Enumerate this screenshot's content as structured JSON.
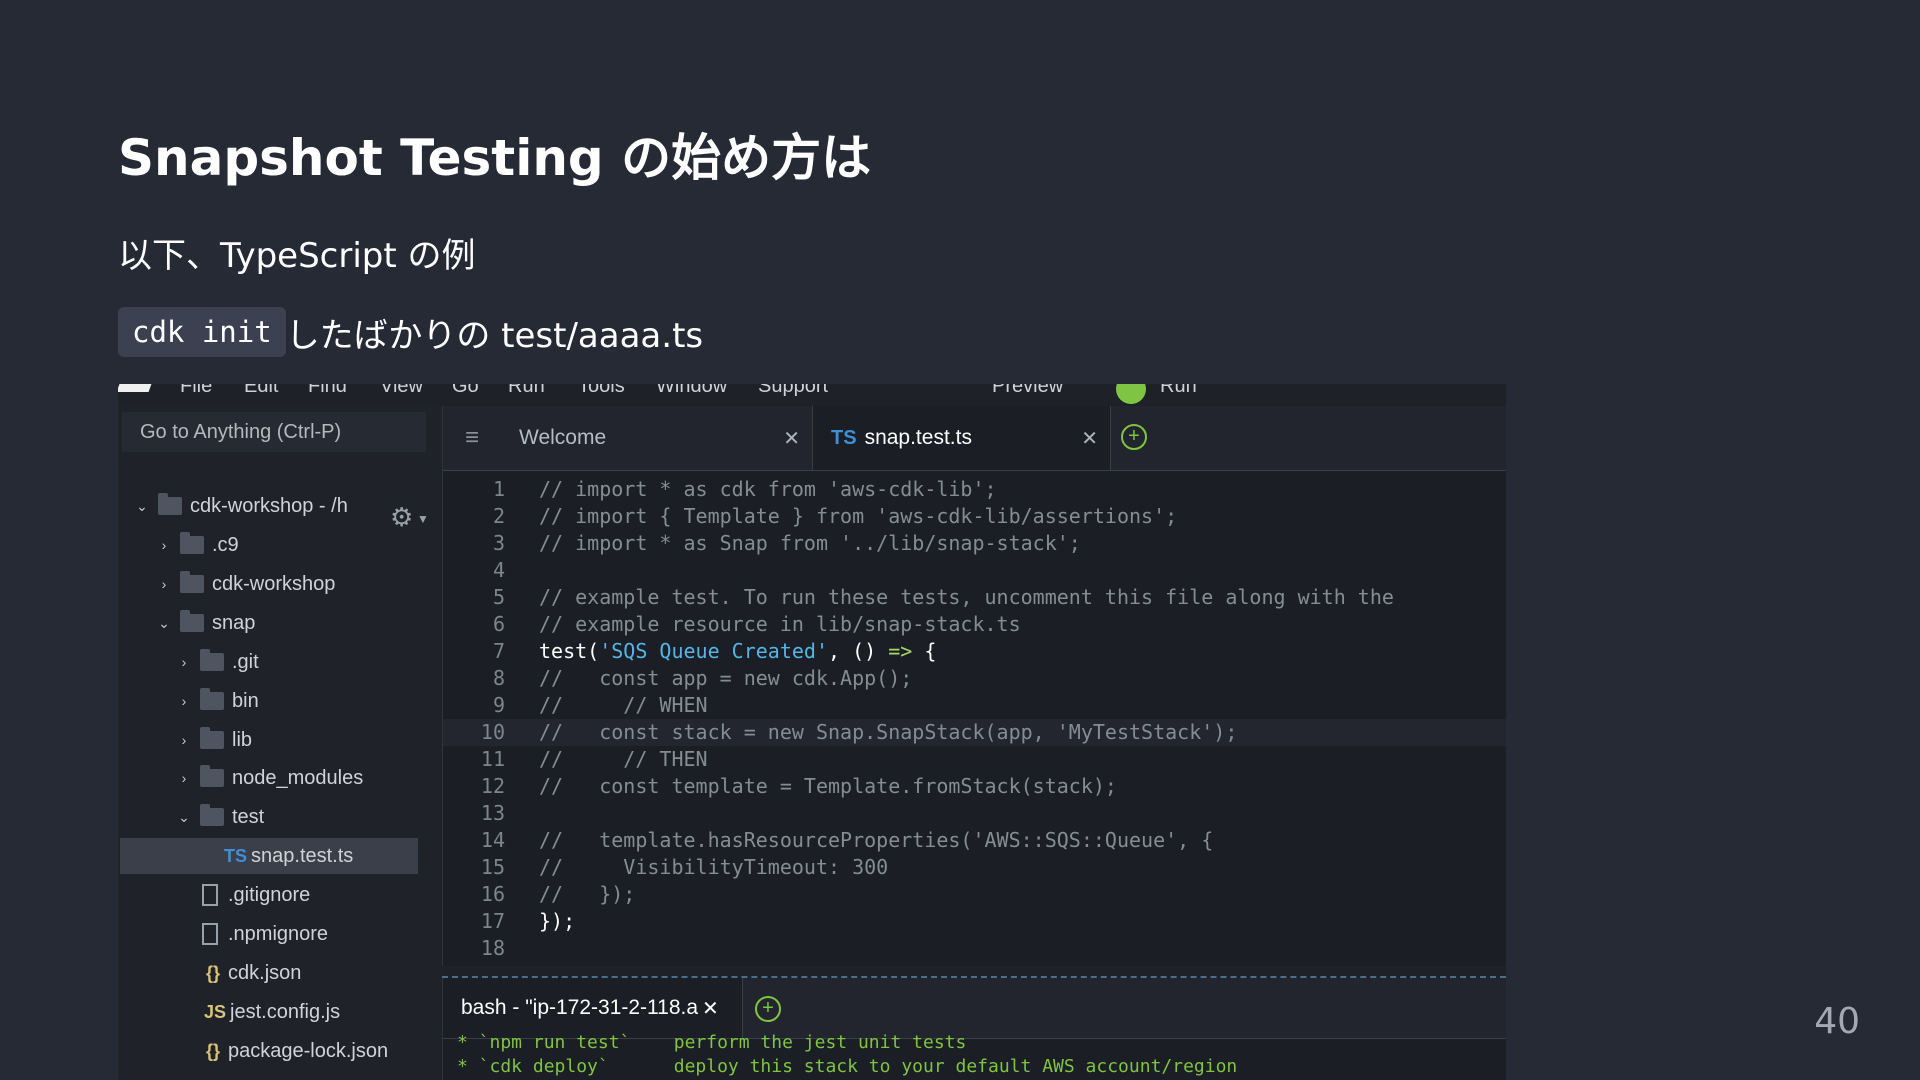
{
  "slide": {
    "title": "Snapshot Testing の始め方は",
    "subtitle": "以下、TypeScript の例",
    "line3_code": "cdk init",
    "line3_text": "したばかりの test/aaaa.ts",
    "page_number": "40"
  },
  "ide": {
    "menubar": [
      "File",
      "Edit",
      "Find",
      "View",
      "Go",
      "Run",
      "Tools",
      "Window",
      "Support",
      "Preview",
      "Run"
    ],
    "goto_placeholder": "Go to Anything (Ctrl-P)",
    "tree": [
      {
        "label": "cdk-workshop - /h",
        "type": "folder",
        "open": true
      },
      {
        "label": ".c9",
        "type": "folder",
        "open": false
      },
      {
        "label": "cdk-workshop",
        "type": "folder",
        "open": false
      },
      {
        "label": "snap",
        "type": "folder",
        "open": true
      },
      {
        "label": ".git",
        "type": "folder",
        "open": false
      },
      {
        "label": "bin",
        "type": "folder",
        "open": false
      },
      {
        "label": "lib",
        "type": "folder",
        "open": false
      },
      {
        "label": "node_modules",
        "type": "folder",
        "open": false
      },
      {
        "label": "test",
        "type": "folder",
        "open": true
      },
      {
        "label": "snap.test.ts",
        "type": "ts-file",
        "selected": true
      },
      {
        "label": ".gitignore",
        "type": "doc-file"
      },
      {
        "label": ".npmignore",
        "type": "doc-file"
      },
      {
        "label": "cdk.json",
        "type": "json-file"
      },
      {
        "label": "jest.config.js",
        "type": "js-file"
      },
      {
        "label": "package-lock.json",
        "type": "json-file"
      }
    ],
    "tabs": [
      {
        "label": "Welcome",
        "active": false
      },
      {
        "label": "snap.test.ts",
        "active": true,
        "badge": "TS"
      }
    ],
    "code_lines": [
      {
        "n": "1",
        "parts": [
          {
            "t": "// import * as cdk from 'aws-cdk-lib';",
            "c": "comment"
          }
        ]
      },
      {
        "n": "2",
        "parts": [
          {
            "t": "// import { Template } from 'aws-cdk-lib/assertions';",
            "c": "comment"
          }
        ]
      },
      {
        "n": "3",
        "parts": [
          {
            "t": "// import * as Snap from '../lib/snap-stack';",
            "c": "comment"
          }
        ]
      },
      {
        "n": "4",
        "parts": []
      },
      {
        "n": "5",
        "parts": [
          {
            "t": "// example test. To run these tests, uncomment this file along with the",
            "c": "comment"
          }
        ]
      },
      {
        "n": "6",
        "parts": [
          {
            "t": "// example resource in lib/snap-stack.ts",
            "c": "comment"
          }
        ]
      },
      {
        "n": "7",
        "parts": [
          {
            "t": "test(",
            "c": "plain"
          },
          {
            "t": "'SQS Queue Created'",
            "c": "string"
          },
          {
            "t": ", () ",
            "c": "plain"
          },
          {
            "t": "=>",
            "c": "arrow"
          },
          {
            "t": " {",
            "c": "plain"
          }
        ]
      },
      {
        "n": "8",
        "parts": [
          {
            "t": "//   const app = new cdk.App();",
            "c": "comment"
          }
        ]
      },
      {
        "n": "9",
        "parts": [
          {
            "t": "//     // WHEN",
            "c": "comment"
          }
        ]
      },
      {
        "n": "10",
        "parts": [
          {
            "t": "//   const stack = new Snap.SnapStack(app, 'MyTestStack');",
            "c": "comment"
          }
        ],
        "current": true
      },
      {
        "n": "11",
        "parts": [
          {
            "t": "//     // THEN",
            "c": "comment"
          }
        ]
      },
      {
        "n": "12",
        "parts": [
          {
            "t": "//   const template = Template.fromStack(stack);",
            "c": "comment"
          }
        ]
      },
      {
        "n": "13",
        "parts": []
      },
      {
        "n": "14",
        "parts": [
          {
            "t": "//   template.hasResourceProperties('AWS::SQS::Queue', {",
            "c": "comment"
          }
        ]
      },
      {
        "n": "15",
        "parts": [
          {
            "t": "//     VisibilityTimeout: 300",
            "c": "comment"
          }
        ]
      },
      {
        "n": "16",
        "parts": [
          {
            "t": "//   });",
            "c": "comment"
          }
        ]
      },
      {
        "n": "17",
        "parts": [
          {
            "t": "});",
            "c": "plain"
          }
        ]
      },
      {
        "n": "18",
        "parts": []
      }
    ],
    "terminal": {
      "tab_label": "bash - \"ip-172-31-2-118.a",
      "lines": [
        "* `npm run test`    perform the jest unit tests",
        "* `cdk deploy`      deploy this stack to your default AWS account/region"
      ]
    }
  }
}
